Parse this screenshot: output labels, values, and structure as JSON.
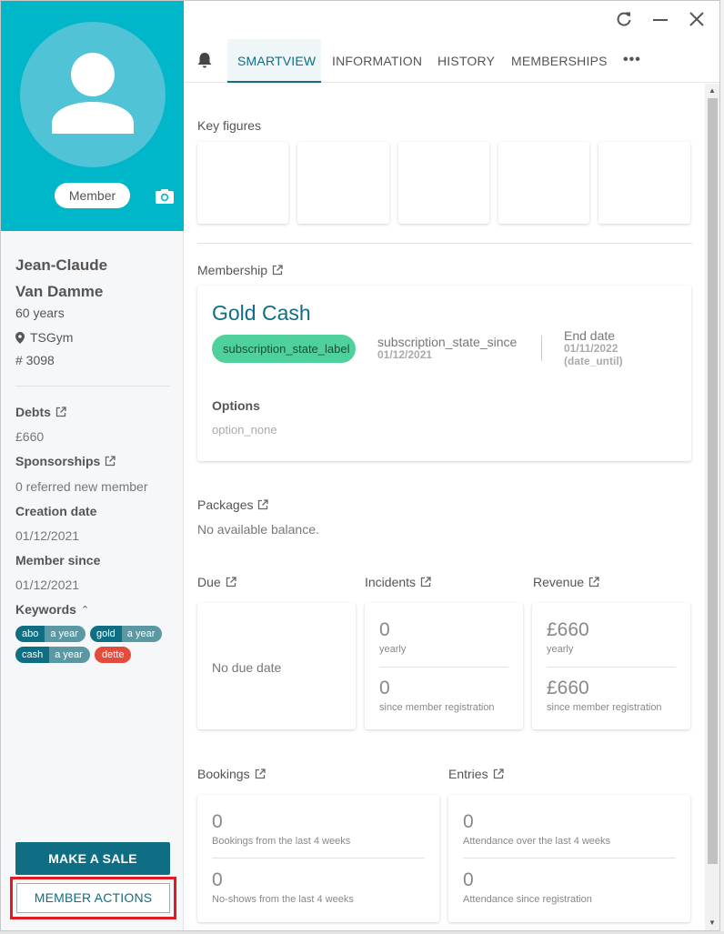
{
  "member": {
    "status_chip": "Member",
    "first_name": "Jean-Claude",
    "last_name": "Van Damme",
    "age": "60 years",
    "location": "TSGym",
    "number": "# 3098"
  },
  "sidebar": {
    "debts_label": "Debts",
    "debts_value": "£660",
    "sponsorships_label": "Sponsorships",
    "sponsorships_value": "0 referred new member",
    "creation_label": "Creation date",
    "creation_value": "01/12/2021",
    "member_since_label": "Member since",
    "member_since_value": "01/12/2021",
    "keywords_label": "Keywords",
    "keywords": [
      {
        "key": "abo",
        "value": "a year"
      },
      {
        "key": "gold",
        "value": "a year"
      },
      {
        "key": "cash",
        "value": "a year"
      }
    ],
    "keyword_single": "dette",
    "make_sale_label": "MAKE A SALE",
    "member_actions_label": "MEMBER ACTIONS"
  },
  "tabs": [
    {
      "label": "SMARTVIEW",
      "active": true
    },
    {
      "label": "INFORMATION",
      "active": false
    },
    {
      "label": "HISTORY",
      "active": false
    },
    {
      "label": "MEMBERSHIPS",
      "active": false
    }
  ],
  "more_tabs": "•••",
  "smartview": {
    "key_figures_title": "Key figures",
    "membership_title": "Membership",
    "membership": {
      "name": "Gold Cash",
      "state": "subscription_state_label",
      "state_since_label": "subscription_state_since",
      "state_since_date": "01/12/2021",
      "end_label": "End date",
      "end_date": "01/11/2022",
      "end_note": "(date_until)",
      "options_label": "Options",
      "options_value": "option_none"
    },
    "packages_title": "Packages",
    "packages_value": "No available balance.",
    "due_title": "Due",
    "due_value": "No due date",
    "incidents_title": "Incidents",
    "incidents": {
      "yearly_value": "0",
      "yearly_label": "yearly",
      "total_value": "0",
      "total_label": "since member registration"
    },
    "revenue_title": "Revenue",
    "revenue": {
      "yearly_value": "£660",
      "yearly_label": "yearly",
      "total_value": "£660",
      "total_label": "since member registration"
    },
    "bookings_title": "Bookings",
    "bookings": {
      "recent_value": "0",
      "recent_label": "Bookings from the last 4 weeks",
      "noshow_value": "0",
      "noshow_label": "No-shows from the last 4 weeks"
    },
    "entries_title": "Entries",
    "entries": {
      "recent_value": "0",
      "recent_label": "Attendance over the last 4 weeks",
      "total_value": "0",
      "total_label": "Attendance since registration"
    }
  },
  "colors": {
    "brand_teal": "#00b6c9",
    "primary_dark_teal": "#0f6e83",
    "state_green": "#4fd19d",
    "alert_red": "#e34b3d",
    "highlight_red": "#e01b24"
  },
  "icons": [
    "refresh-icon",
    "minimize-icon",
    "close-icon",
    "bell-icon",
    "camera-icon",
    "location-pin-icon",
    "external-link-icon",
    "chevron-up-icon",
    "person-icon"
  ]
}
